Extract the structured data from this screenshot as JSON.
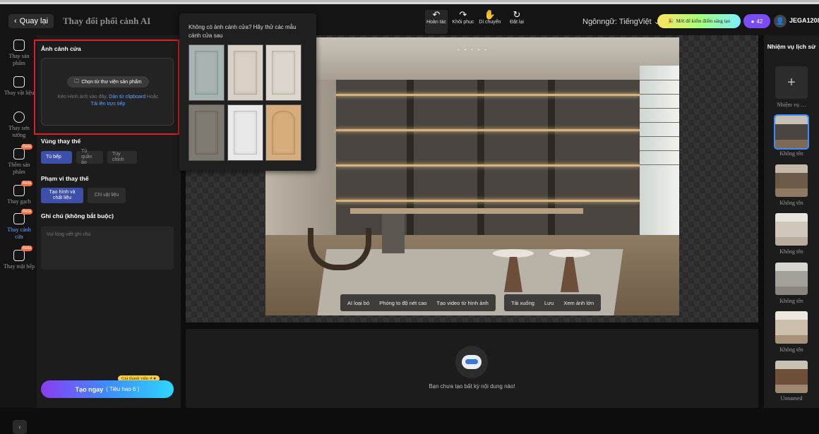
{
  "header": {
    "back_label": "Quay lại",
    "title": "Thay đổi phối cảnh AI",
    "tools": [
      {
        "icon": "undo-icon",
        "label": "Hoàn tác",
        "active": true
      },
      {
        "icon": "redo-icon",
        "label": "Khôi phục"
      },
      {
        "icon": "hand-icon",
        "label": "Di chuyển"
      },
      {
        "icon": "reset-icon",
        "label": "Đặt lại"
      }
    ],
    "language_label": "Ngônngữ: TiếngViệt",
    "promo_label": "Mời để kiếm điểm sáng tạo",
    "credits": "42",
    "username": "JEGA1208"
  },
  "leftnav": {
    "items": [
      {
        "label": "Thay sản phẩm",
        "icon": "cube-icon"
      },
      {
        "label": "Thay vật liệu",
        "icon": "material-icon"
      },
      {
        "label": "Thay sơn tường",
        "icon": "paint-icon"
      },
      {
        "label": "Thêm sản phẩm",
        "icon": "add-product-icon",
        "badge": "Beta"
      },
      {
        "label": "Thay gạch",
        "icon": "tile-icon",
        "badge": "Beta"
      },
      {
        "label": "Thay cánh cửa",
        "icon": "door-icon",
        "badge": "Beta",
        "active": true
      },
      {
        "label": "Thay mặt bếp",
        "icon": "countertop-icon",
        "badge": "Beta"
      }
    ]
  },
  "panel": {
    "door_image_title": "Ảnh cánh cửa",
    "library_button": "Chọn từ thư viện sản phẩm",
    "upload_hint_prefix": "Kéo Hình ảnh vào đây,",
    "upload_hint_clipboard": "Dán từ clipboard",
    "upload_hint_or": "Hoặc",
    "upload_hint_direct": "Tải lên trực tiếp",
    "replace_area_title": "Vùng thay thế",
    "replace_area_options": [
      "Tủ bếp",
      "Tủ quần áo",
      "Tùy chỉnh"
    ],
    "replace_area_selected": 0,
    "replace_scope_title": "Phạm vi thay thế",
    "replace_scope_options": [
      "Tạo hình và chất liệu",
      "Chỉ vật liệu"
    ],
    "replace_scope_selected": 0,
    "note_title": "Ghi chú (không bắt buộc)",
    "note_placeholder": "Vui lòng viết ghi chú",
    "price_label": "Giá thành viên 4",
    "create_label": "Tạo ngay",
    "create_sub": "( Tiêu hao 6 )"
  },
  "popover": {
    "text": "Không có ảnh cánh cửa? Hãy thử các mẫu cánh cửa sau",
    "samples": [
      {
        "name": "sage-shaker-door",
        "color": "#a7b4b3"
      },
      {
        "name": "beige-shaker-door",
        "color": "#d9d0c6"
      },
      {
        "name": "cream-shaker-door",
        "color": "#ddd6cd"
      },
      {
        "name": "gray-slab-door",
        "color": "#7f7a71"
      },
      {
        "name": "white-raised-door",
        "color": "#e9e9ea"
      },
      {
        "name": "oak-arched-door",
        "color": "#d7ad7c"
      }
    ]
  },
  "canvas": {
    "page_indicator": "- - - - -",
    "toolbar_left": [
      "AI loại bỏ",
      "Phóng to độ nét cao",
      "Tạo video từ hình ảnh"
    ],
    "toolbar_right": [
      "Tải xuống",
      "Lưu",
      "Xem ảnh lớn"
    ]
  },
  "result": {
    "empty_text": "Bạn chưa tạo bất kỳ nội dung nào!"
  },
  "history": {
    "title": "Nhiệm vụ lịch sử",
    "new_task_label": "Nhiệm vụ …",
    "items": [
      {
        "label": "Không tên",
        "selected": true,
        "colors": [
          "#c6c0b6",
          "#4a4540",
          "#7d6a55"
        ]
      },
      {
        "label": "Không tên",
        "colors": [
          "#c2b8a9",
          "#6b5a48",
          "#8e7a62"
        ]
      },
      {
        "label": "Không tên",
        "colors": [
          "#e8e4de",
          "#cfc7bb",
          "#b8ada0"
        ]
      },
      {
        "label": "Không tên",
        "colors": [
          "#d8d6d1",
          "#a4a09a",
          "#8a857d"
        ]
      },
      {
        "label": "Không tên",
        "colors": [
          "#ece7df",
          "#cdbfae",
          "#a79279"
        ]
      },
      {
        "label": "Unnamed",
        "colors": [
          "#c9c1b3",
          "#6d4f3a",
          "#a08870"
        ]
      }
    ]
  }
}
